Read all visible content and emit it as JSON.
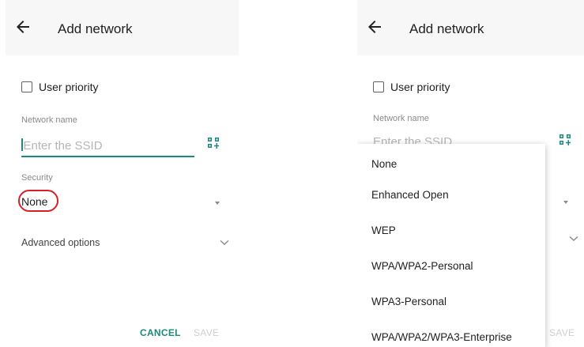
{
  "left": {
    "title": "Add network",
    "user_priority": "User priority",
    "network_name_label": "Network name",
    "ssid_placeholder": "Enter the SSID",
    "security_label": "Security",
    "security_value": "None",
    "advanced_options": "Advanced options",
    "cancel": "CANCEL",
    "save": "SAVE"
  },
  "right": {
    "title": "Add network",
    "user_priority": "User priority",
    "network_name_label": "Network name",
    "ssid_placeholder": "Enter the SSID",
    "save": "SAVE",
    "security_options": [
      "None",
      "Enhanced Open",
      "WEP",
      "WPA/WPA2-Personal",
      "WPA3-Personal",
      "WPA/WPA2/WPA3-Enterprise"
    ]
  },
  "colors": {
    "accent": "#1a8a7e",
    "highlight": "#d81f26",
    "appbar": "#f7f7f7"
  },
  "icons": {
    "back": "arrow-back-icon",
    "qr": "qr-code-scan-icon",
    "dropdown": "dropdown-triangle-icon",
    "chevron": "chevron-down-icon"
  }
}
